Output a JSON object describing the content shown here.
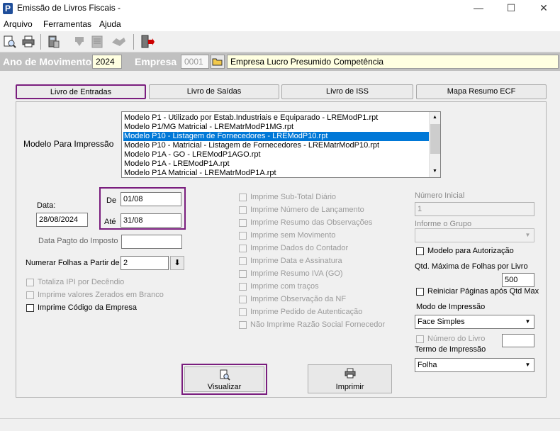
{
  "window": {
    "title": "Emissão de Livros Fiscais -",
    "minimize": "—",
    "maximize": "☐",
    "close": "✕"
  },
  "menu": [
    "Arquivo",
    "Ferramentas",
    "Ajuda"
  ],
  "header": {
    "ano_label": "Ano de Movimento",
    "ano_value": "2024",
    "empresa_label": "Empresa",
    "empresa_code": "0001",
    "empresa_name": "Empresa Lucro Presumido Competência"
  },
  "tabs": [
    {
      "label": "Livro de Entradas",
      "active": true
    },
    {
      "label": "Livro de Saídas",
      "active": false
    },
    {
      "label": "Livro de ISS",
      "active": false
    },
    {
      "label": "Mapa Resumo ECF",
      "active": false
    }
  ],
  "modelo": {
    "label": "Modelo Para Impressão",
    "items": [
      "Modelo P1 - Utilizado por Estab.Industriais e Equiparado - LREModP1.rpt",
      "Modelo P1/MG Matricial - LREMatrModP1MG.rpt",
      "Modelo P10 - Listagem de Fornecedores - LREModP10.rpt",
      "Modelo P10 - Matricial - Listagem de Fornecedores - LREMatrModP10.rpt",
      "Modelo P1A - GO - LREModP1AGO.rpt",
      "Modelo P1A - LREModP1A.rpt",
      "Modelo P1A Matricial - LREMatrModP1A.rpt"
    ],
    "selected_index": 2
  },
  "dates": {
    "data_label": "Data:",
    "data_value": "28/08/2024",
    "de_label": "De",
    "de_value": "01/08",
    "ate_label": "Até",
    "ate_value": "31/08",
    "pagto_label": "Data Pagto do Imposto",
    "pagto_value": ""
  },
  "numerar": {
    "label": "Numerar Folhas a Partir de",
    "value": "2"
  },
  "left_checks": [
    {
      "label": "Totaliza IPI por Decêndio",
      "enabled": false,
      "checked": false
    },
    {
      "label": "Imprime valores Zerados em Branco",
      "enabled": false,
      "checked": false
    },
    {
      "label": "Imprime Código da Empresa",
      "enabled": true,
      "checked": false
    }
  ],
  "middle_checks": [
    "Imprime Sub-Total Diário",
    "Imprime Número de Lançamento",
    "Imprime Resumo das Observações",
    "Imprime sem Movimento",
    "Imprime Dados do Contador",
    "Imprime Data e Assinatura",
    "Imprime Resumo IVA (GO)",
    "Imprime com traços",
    "Imprime Observação da NF",
    "Imprime Pedido de Autenticação",
    "Não Imprime Razão Social Fornecedor"
  ],
  "right": {
    "numero_inicial_label": "Número Inicial",
    "numero_inicial_value": "1",
    "grupo_label": "Informe o Grupo",
    "grupo_value": "",
    "modelo_autorizacao_label": "Modelo para Autorização",
    "qtd_max_label": "Qtd. Máxima de Folhas por Livro",
    "qtd_max_value": "500",
    "reiniciar_label": "Reiniciar Páginas após Qtd Max",
    "modo_label": "Modo de Impressão",
    "modo_value": "Face Simples",
    "numero_livro_label": "Número do Livro",
    "numero_livro_value": "",
    "termo_label": "Termo de Impressão",
    "termo_value": "Folha"
  },
  "actions": {
    "visualizar": "Visualizar",
    "imprimir": "Imprimir"
  },
  "colors": {
    "highlight": "#7a1e7e",
    "selection": "#0078d7",
    "header_strip": "#c0c0c0",
    "empresa_name_bg": "#ffffe1"
  }
}
